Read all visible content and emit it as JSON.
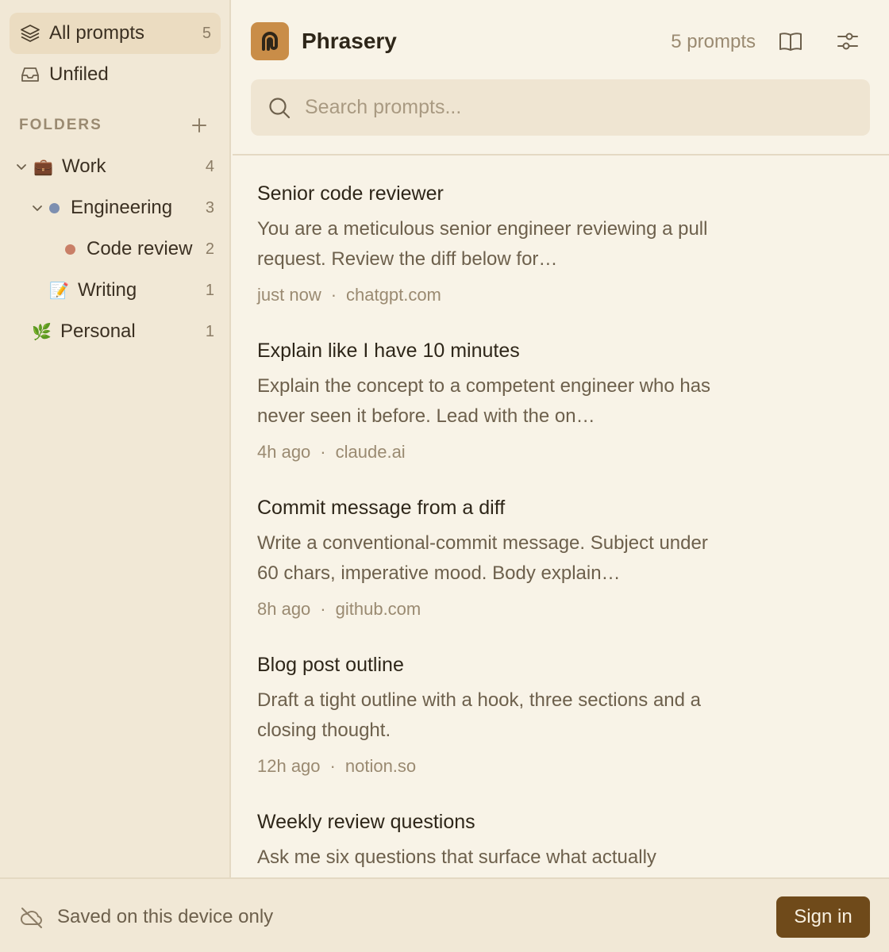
{
  "sidebar": {
    "all_prompts": {
      "label": "All prompts",
      "count": "5"
    },
    "unfiled": {
      "label": "Unfiled"
    },
    "folders_label": "FOLDERS",
    "tree": [
      {
        "label": "Work",
        "count": "4",
        "emoji": "💼",
        "expanded": true
      },
      {
        "label": "Engineering",
        "count": "3",
        "color": "#7d8fb0",
        "expanded": true
      },
      {
        "label": "Code review",
        "count": "2",
        "color": "#c97f67"
      },
      {
        "label": "Writing",
        "count": "1",
        "emoji": "📝"
      },
      {
        "label": "Personal",
        "count": "1",
        "emoji": "🌿"
      }
    ]
  },
  "header": {
    "app_name": "Phrasery",
    "prompt_count": "5 prompts",
    "search_placeholder": "Search prompts..."
  },
  "prompts": [
    {
      "title": "Senior code reviewer",
      "body": "You are a meticulous senior engineer reviewing a pull request. Review the diff below for…",
      "time": "just now",
      "source": "chatgpt.com"
    },
    {
      "title": "Explain like I have 10 minutes",
      "body": "Explain the concept to a competent engineer who has never seen it before. Lead with the on…",
      "time": "4h ago",
      "source": "claude.ai"
    },
    {
      "title": "Commit message from a diff",
      "body": "Write a conventional-commit message. Subject under 60 chars, imperative mood. Body explain…",
      "time": "8h ago",
      "source": "github.com"
    },
    {
      "title": "Blog post outline",
      "body": "Draft a tight outline with a hook, three sections and a closing thought.",
      "time": "12h ago",
      "source": "notion.so"
    },
    {
      "title": "Weekly review questions",
      "body": "Ask me six questions that surface what actually",
      "time": "",
      "source": ""
    }
  ],
  "footer": {
    "status": "Saved on this device only",
    "signin_label": "Sign in"
  },
  "colors": {
    "accent": "#6f4a1a",
    "logo": "#c98d48",
    "background": "#f8f3e7",
    "sidebar": "#f1e8d6"
  }
}
